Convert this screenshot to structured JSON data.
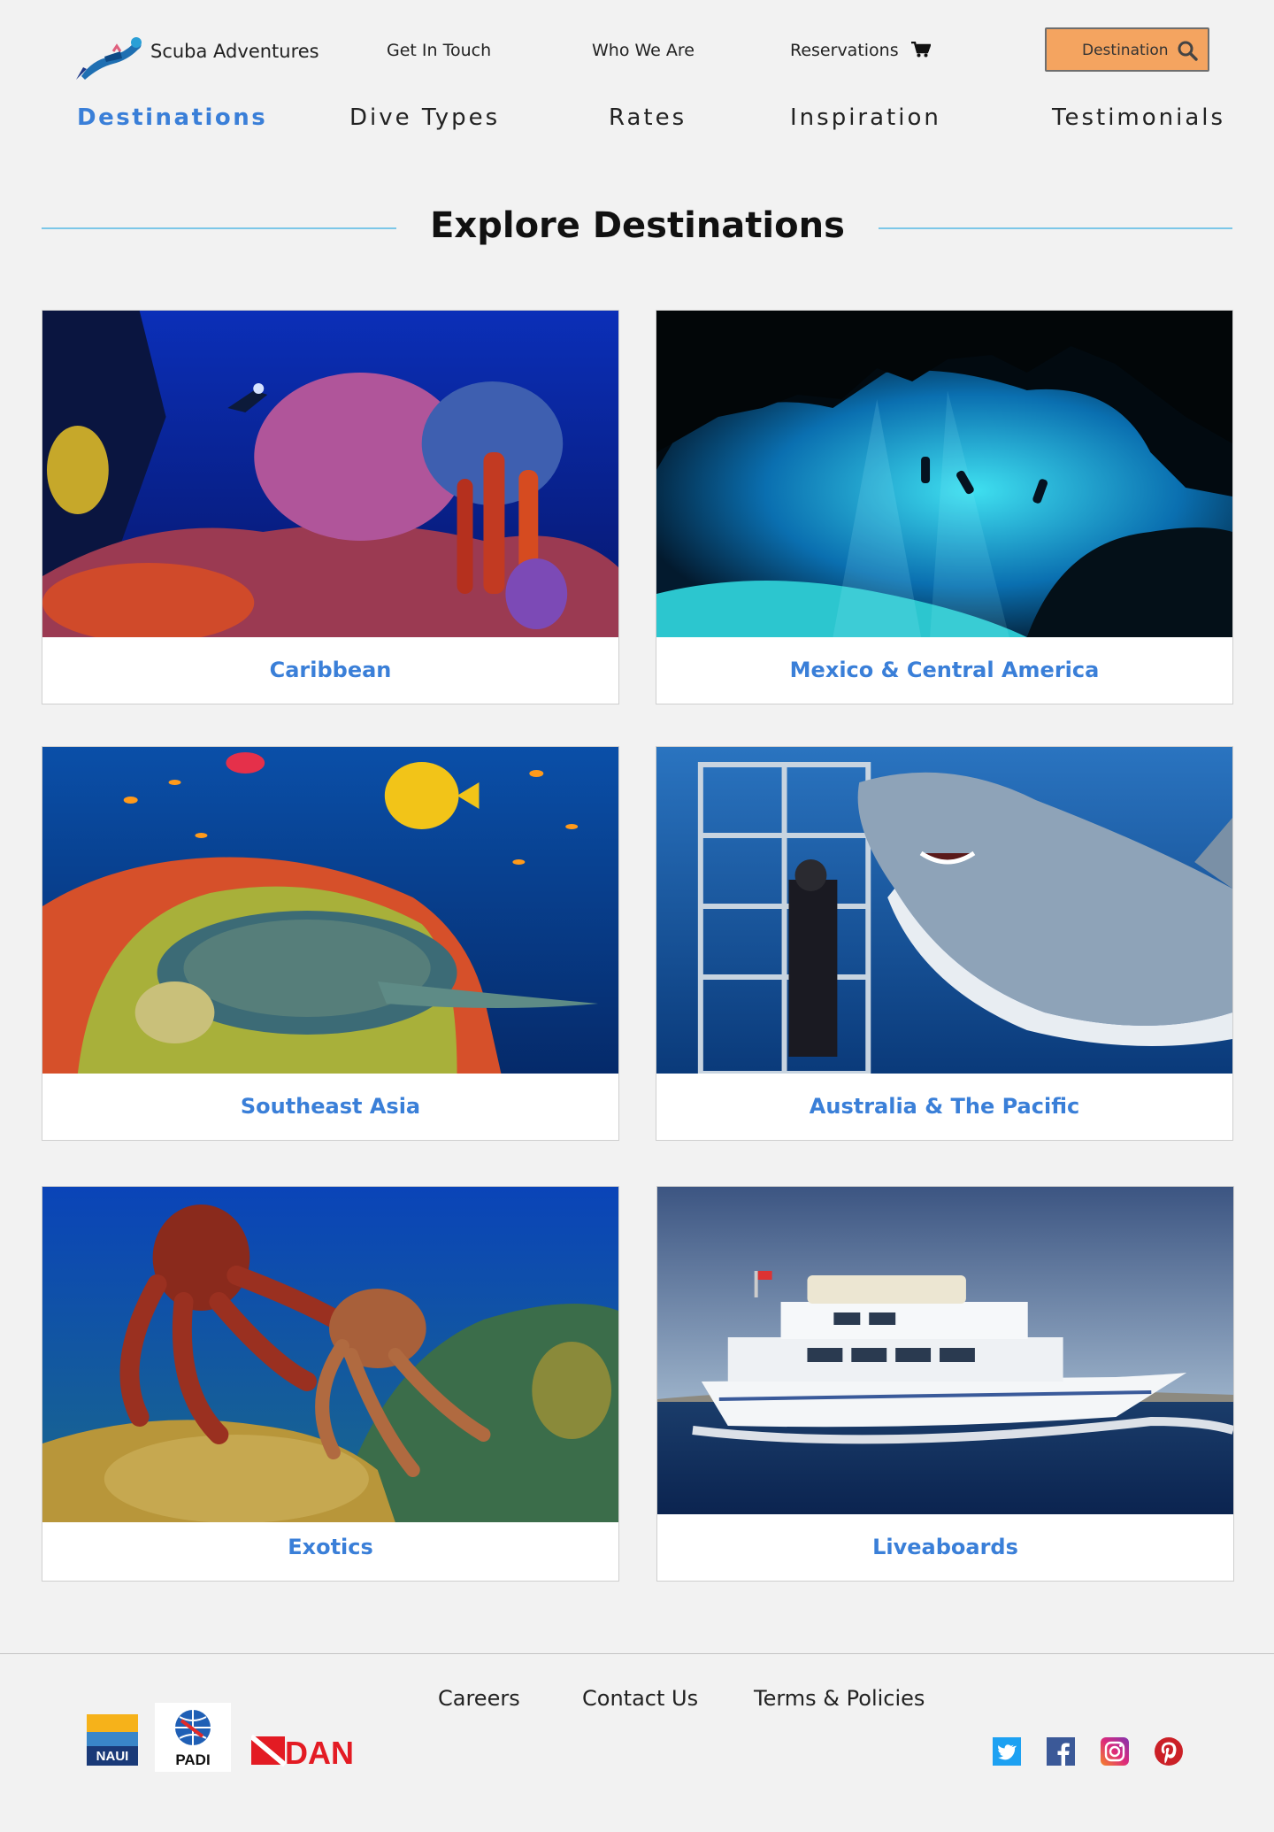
{
  "brand": {
    "name": "Scuba Adventures"
  },
  "utility_nav": {
    "get_in_touch": "Get In Touch",
    "who_we_are": "Who We Are",
    "reservations": "Reservations",
    "search_button_label": "Destination"
  },
  "main_nav": {
    "items": [
      {
        "label": "Destinations",
        "active": true
      },
      {
        "label": "Dive Types",
        "active": false
      },
      {
        "label": "Rates",
        "active": false
      },
      {
        "label": "Inspiration",
        "active": false
      },
      {
        "label": "Testimonials",
        "active": false
      }
    ]
  },
  "section": {
    "title": "Explore Destinations"
  },
  "destinations": [
    {
      "label": "Caribbean",
      "image": "coral-reef-diver-photo"
    },
    {
      "label": "Mexico & Central America",
      "image": "cenote-cave-divers-photo"
    },
    {
      "label": "Southeast Asia",
      "image": "sea-turtle-reef-photo"
    },
    {
      "label": "Australia & The Pacific",
      "image": "shark-cage-diving-photo"
    },
    {
      "label": "Exotics",
      "image": "octopus-reef-photo"
    },
    {
      "label": "Liveaboards",
      "image": "liveaboard-yacht-photo"
    }
  ],
  "footer": {
    "links": [
      "Careers",
      "Contact Us",
      "Terms & Policies"
    ],
    "partners": [
      "NAUI",
      "PADI",
      "DAN"
    ],
    "social": [
      "twitter-icon",
      "facebook-icon",
      "instagram-icon",
      "pinterest-icon"
    ]
  },
  "colors": {
    "accent": "#3a7fd8",
    "button": "#f4a460",
    "rule": "#7cc7e8",
    "background": "#f2f2f2"
  }
}
